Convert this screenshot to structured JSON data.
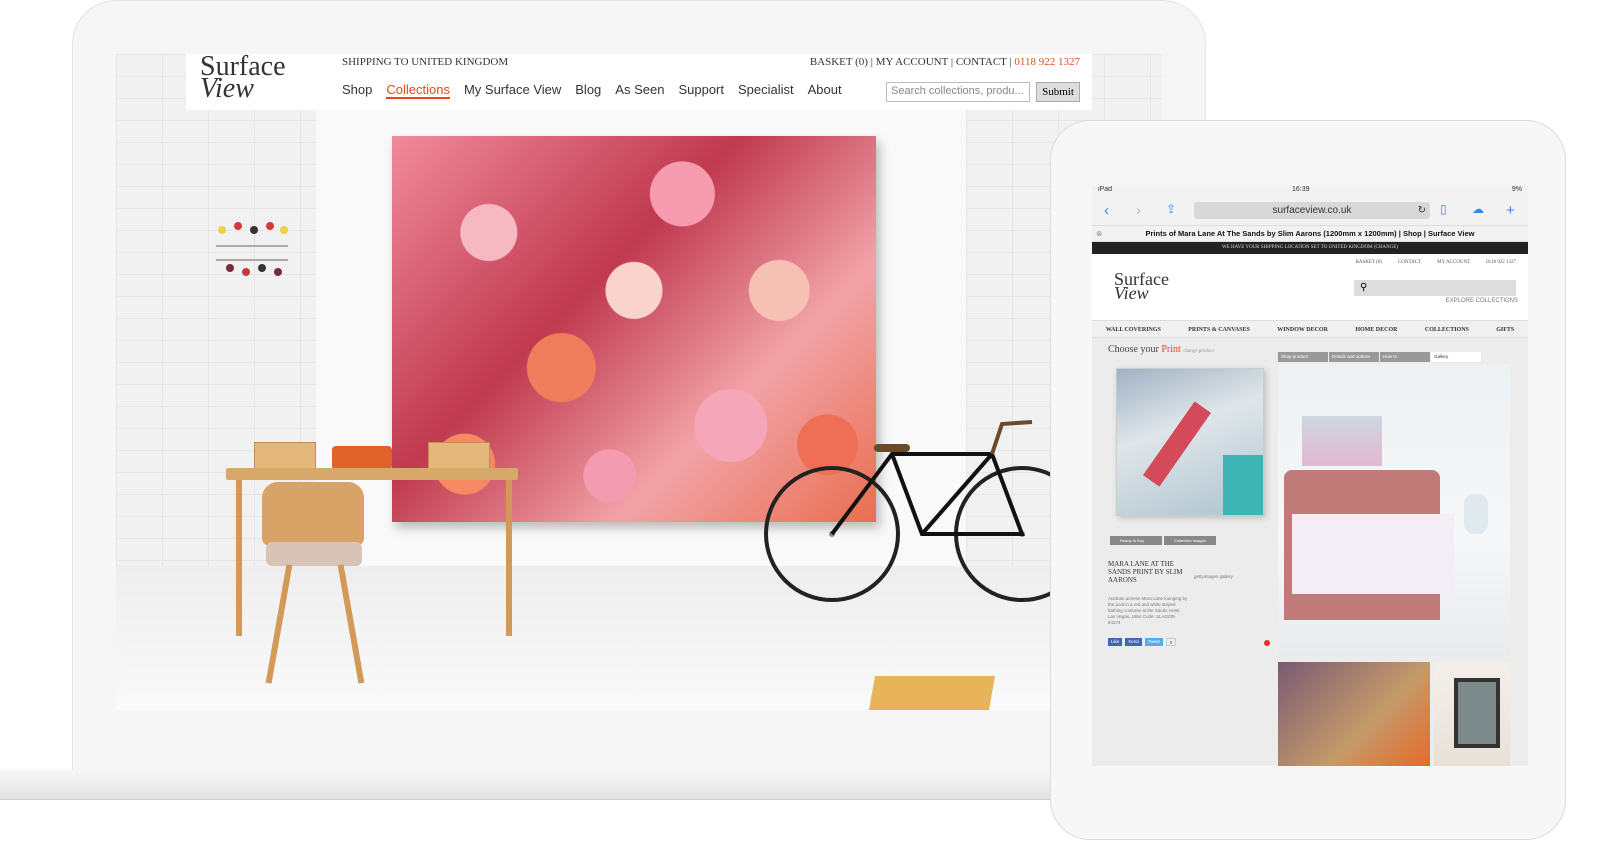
{
  "laptop": {
    "header": {
      "logo_line1": "Surface",
      "logo_line2": "View",
      "shipping": "SHIPPING TO UNITED KINGDOM",
      "basket": "BASKET (0)",
      "account": "MY ACCOUNT",
      "contact": "CONTACT",
      "sep": " | ",
      "phone": "0118 922 1327"
    },
    "nav": [
      {
        "label": "Shop"
      },
      {
        "label": "Collections"
      },
      {
        "label": "My Surface View"
      },
      {
        "label": "Blog"
      },
      {
        "label": "As Seen"
      },
      {
        "label": "Support"
      },
      {
        "label": "Specialist"
      },
      {
        "label": "About"
      }
    ],
    "search": {
      "placeholder": "Search collections, produ..."
    },
    "submit_label": "Submit"
  },
  "tablet": {
    "status": {
      "device": "iPad",
      "time": "16:39",
      "battery": "9%"
    },
    "url": "surfaceview.co.uk",
    "tab_title": "Prints of Mara Lane At The Sands by Slim Aarons (1200mm x 1200mm) | Shop | Surface View",
    "banner": "WE HAVE YOUR SHIPPING LOCATION SET TO UNITED KINGDOM (CHANGE)",
    "util": [
      "BASKET (0)",
      "CONTACT",
      "MY ACCOUNT",
      "0118 922 1327"
    ],
    "logo_line1": "Surface",
    "logo_line2": "View",
    "explore": "EXPLORE COLLECTIONS",
    "nav": [
      "WALL COVERINGS",
      "PRINTS & CANVASES",
      "WINDOW DECOR",
      "HOME DECOR",
      "COLLECTIONS",
      "GIFTS"
    ],
    "choose_prefix": "Choose your",
    "choose_word": "Print",
    "choose_sub": "change product",
    "tabs": [
      "Shop product",
      "Details and options",
      "How to",
      "Gallery"
    ],
    "buttons": [
      "Ready to Buy",
      "Collection Images"
    ],
    "product_title": "MARA LANE AT THE SANDS PRINT BY SLIM AARONS",
    "gettys": "gettyimages gallery",
    "desc": "Austrian actress Mara Lane lounging by the pool in a red and white striped bathing costume at the Sands Hotel, Las Vegas, 1954 Code: SLA0230-94274",
    "social": [
      "Like",
      "Send",
      "Tweet",
      "0"
    ]
  },
  "colors": {
    "accent": "#e34a1a",
    "link_blue": "#3a84f2"
  }
}
